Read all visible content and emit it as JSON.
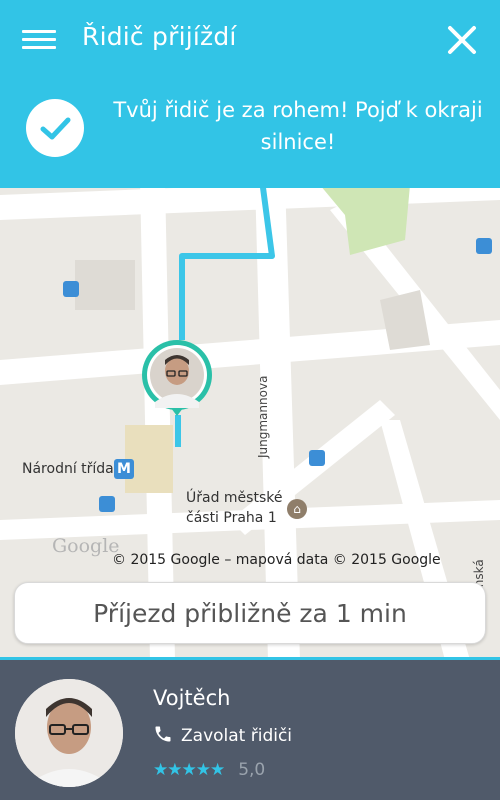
{
  "app": {
    "title": "Řidič přijíždí"
  },
  "notice": {
    "message": "Tvůj řidič je za rohem! Pojď k okraji silnice!"
  },
  "map": {
    "station_label": "Národní třída",
    "metro_badge": "M",
    "office_label_line1": "Úřad městské",
    "office_label_line2": "části Praha 1",
    "street_label": "Jungmannova",
    "street_label_2": "...ánská",
    "google_logo": "Google",
    "attribution": "© 2015 Google – mapová data © 2015 Google"
  },
  "eta": {
    "text": "Příjezd přibližně za 1 min"
  },
  "driver": {
    "name": "Vojtěch",
    "call_label": "Zavolat řidiči",
    "stars": "★★★★★",
    "rating": "5,0"
  },
  "colors": {
    "accent": "#32c4e6",
    "panel": "#505a6a",
    "route": "#3cc6e8"
  },
  "icons": {
    "menu": "hamburger-icon",
    "close": "close-icon",
    "check": "check-icon",
    "phone": "phone-icon"
  }
}
